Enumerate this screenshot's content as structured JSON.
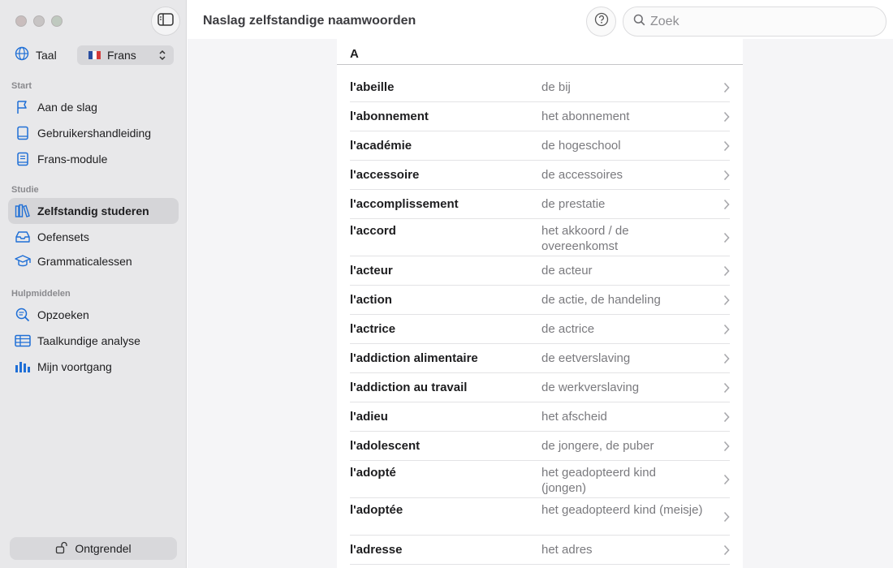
{
  "window": {
    "title": "Naslag zelfstandige naamwoorden"
  },
  "colors": {
    "accent": "#1f6fd6",
    "sidebar_bg": "#e8e8ea",
    "flag_blue": "#2a4ea0",
    "flag_white": "#ffffff",
    "flag_red": "#d43b3b"
  },
  "sidebar": {
    "language_label": "Taal",
    "language_value": "Frans",
    "sections": [
      {
        "label": "Start",
        "items": [
          {
            "label": "Aan de slag",
            "icon": "flag-icon"
          },
          {
            "label": "Gebruikershandleiding",
            "icon": "book-icon"
          },
          {
            "label": "Frans-module",
            "icon": "module-book-icon"
          }
        ]
      },
      {
        "label": "Studie",
        "items": [
          {
            "label": "Zelfstandig studeren",
            "icon": "books-shelf-icon",
            "active": true
          },
          {
            "label": "Oefensets",
            "icon": "tray-icon"
          },
          {
            "label": "Grammaticalessen",
            "icon": "graduation-cap-icon"
          }
        ]
      },
      {
        "label": "Hulpmiddelen",
        "items": [
          {
            "label": "Opzoeken",
            "icon": "magnifier-text-icon"
          },
          {
            "label": "Taalkundige analyse",
            "icon": "table-icon"
          },
          {
            "label": "Mijn voortgang",
            "icon": "bar-chart-icon"
          }
        ]
      }
    ],
    "unlock_label": "Ontgrendel"
  },
  "search": {
    "placeholder": "Zoek"
  },
  "list": {
    "letter": "A",
    "entries": [
      {
        "french": "l'abeille",
        "dutch": "de bij"
      },
      {
        "french": "l'abonnement",
        "dutch": "het abonnement"
      },
      {
        "french": "l'académie",
        "dutch": "de hogeschool"
      },
      {
        "french": "l'accessoire",
        "dutch": "de accessoires"
      },
      {
        "french": "l'accomplissement",
        "dutch": "de prestatie"
      },
      {
        "french": "l'accord",
        "dutch": "het akkoord / de overeenkomst"
      },
      {
        "french": "l'acteur",
        "dutch": "de acteur"
      },
      {
        "french": "l'action",
        "dutch": "de actie, de handeling"
      },
      {
        "french": "l'actrice",
        "dutch": "de actrice"
      },
      {
        "french": "l'addiction alimentaire",
        "dutch": "de eetverslaving"
      },
      {
        "french": "l'addiction au travail",
        "dutch": "de werkverslaving"
      },
      {
        "french": "l'adieu",
        "dutch": "het afscheid"
      },
      {
        "french": "l'adolescent",
        "dutch": "de jongere, de puber"
      },
      {
        "french": "l'adopté",
        "dutch": "het geadopteerd kind (jongen)"
      },
      {
        "french": "l'adoptée",
        "dutch": "het geadopteerd kind (meisje)"
      },
      {
        "french": "l'adresse",
        "dutch": "het adres"
      }
    ]
  }
}
